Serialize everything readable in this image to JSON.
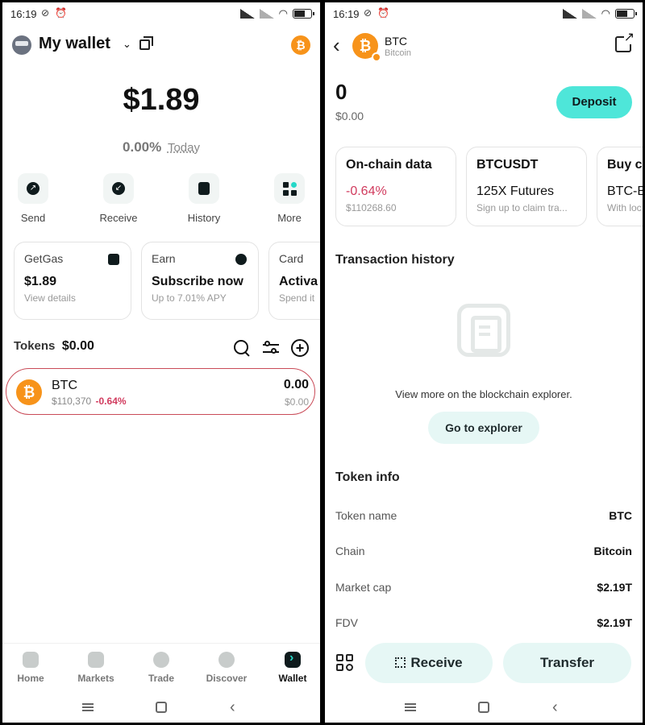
{
  "status_bar": {
    "time": "16:19"
  },
  "wallet": {
    "title": "My wallet",
    "balance": "$1.89",
    "change_pct": "0.00%",
    "change_period": "Today",
    "actions": [
      {
        "label": "Send",
        "icon": "send-icon"
      },
      {
        "label": "Receive",
        "icon": "receive-icon"
      },
      {
        "label": "History",
        "icon": "history-icon"
      },
      {
        "label": "More",
        "icon": "more-grid-icon"
      }
    ],
    "cards": [
      {
        "title": "GetGas",
        "value": "$1.89",
        "sub": "View details",
        "icon": "gas-icon"
      },
      {
        "title": "Earn",
        "value": "Subscribe now",
        "sub": "Up to 7.01% APY",
        "icon": "piggy-bank-icon"
      },
      {
        "title": "Card",
        "value": "Activa",
        "sub": "Spend it",
        "icon": ""
      }
    ],
    "tokens_label": "Tokens",
    "tokens_total": "$0.00",
    "token": {
      "name": "BTC",
      "price": "$110,370",
      "change": "-0.64%",
      "qty": "0.00",
      "usd": "$0.00",
      "icon": "bitcoin-icon"
    }
  },
  "nav": {
    "items": [
      {
        "label": "Home",
        "icon": "home-icon"
      },
      {
        "label": "Markets",
        "icon": "markets-icon"
      },
      {
        "label": "Trade",
        "icon": "trade-icon"
      },
      {
        "label": "Discover",
        "icon": "discover-icon"
      },
      {
        "label": "Wallet",
        "icon": "wallet-icon",
        "active": true
      }
    ]
  },
  "detail": {
    "name": "BTC",
    "network": "Bitcoin",
    "qty": "0",
    "usd": "$0.00",
    "deposit_label": "Deposit",
    "cards": [
      {
        "title": "On-chain data",
        "value": "-0.64%",
        "sub": "$110268.60"
      },
      {
        "title": "BTCUSDT",
        "value": "125X Futures",
        "sub": "Sign up to claim tra..."
      },
      {
        "title": "Buy c",
        "value": "BTC-B",
        "sub": "With loc"
      }
    ],
    "tx_title": "Transaction history",
    "explorer_text": "View more on the blockchain explorer.",
    "explorer_btn": "Go to explorer",
    "info_title": "Token info",
    "info": [
      {
        "k": "Token name",
        "v": "BTC"
      },
      {
        "k": "Chain",
        "v": "Bitcoin"
      },
      {
        "k": "Market cap",
        "v": "$2.19T"
      },
      {
        "k": "FDV",
        "v": "$2.19T"
      }
    ],
    "receive_label": "Receive",
    "transfer_label": "Transfer"
  },
  "colors": {
    "accent": "#4ee6d9",
    "negative": "#d13b5e",
    "bitcoin": "#f7931a"
  }
}
